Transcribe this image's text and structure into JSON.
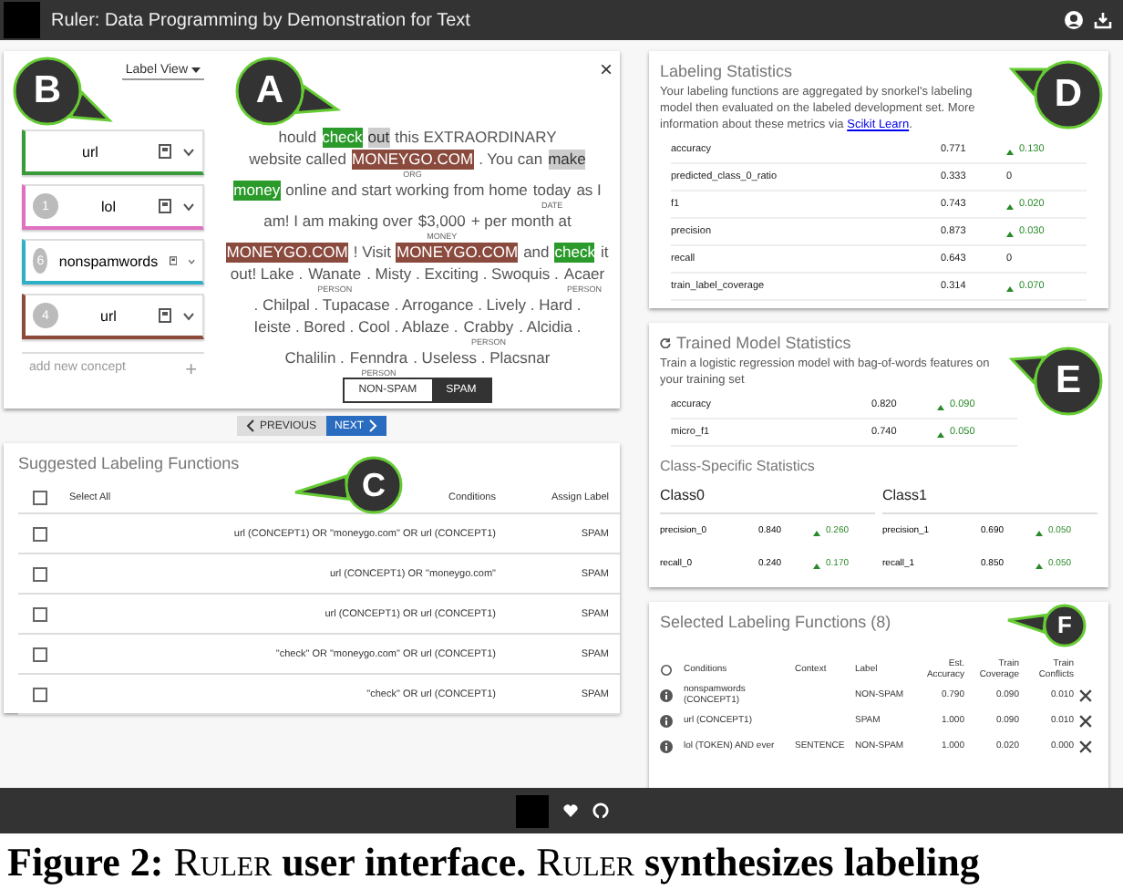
{
  "header": {
    "title": "Ruler: Data Programming by Demonstration for Text"
  },
  "concept_panel": {
    "view_menu": "Label View",
    "concepts": [
      {
        "name": "url",
        "color": "#3a9a3a"
      },
      {
        "count": "1",
        "name": "lol",
        "color": "#e070c0"
      },
      {
        "count": "6",
        "name": "nonspamwords",
        "color": "#30b0c8"
      },
      {
        "count": "4",
        "name": "url",
        "color": "#8b4a3a"
      }
    ],
    "add_label": "add new concept",
    "add_button": "+"
  },
  "document": {
    "close": "×",
    "lines": [
      [
        {
          "text": "hould"
        },
        {
          "text": "check",
          "kind": "concept"
        },
        {
          "text": "out",
          "kind": "selected"
        },
        {
          "text": "this EXTRAORDINARY"
        }
      ],
      [
        {
          "text": "website called"
        },
        {
          "text": "MONEYGO.COM",
          "kind": "match",
          "tag": "ORG"
        },
        {
          "text": ". You can"
        },
        {
          "text": "make",
          "kind": "selected"
        }
      ],
      [
        {
          "text": "money",
          "kind": "concept"
        },
        {
          "text": "online and start working from home"
        },
        {
          "text": "today",
          "tag": "DATE"
        },
        {
          "text": "as I"
        }
      ],
      [
        {
          "text": "am! I am making over"
        },
        {
          "text": "$3,000",
          "tag": "MONEY"
        },
        {
          "text": "+ per month at"
        }
      ],
      [
        {
          "text": "MONEYGO.COM",
          "kind": "match"
        },
        {
          "text": "! Visit"
        },
        {
          "text": "MONEYGO.COM",
          "kind": "match"
        },
        {
          "text": "and"
        },
        {
          "text": "check",
          "kind": "concept"
        },
        {
          "text": "it"
        }
      ],
      [
        {
          "text": "out! Lake ."
        },
        {
          "text": "Wanate",
          "tag": "PERSON"
        },
        {
          "text": ". Misty . Exciting . Swoquis ."
        },
        {
          "text": "Acaer",
          "tag": "PERSON"
        }
      ],
      [
        {
          "text": ". Chilpal . Tupacase . Arrogance . Lively . Hard ."
        }
      ],
      [
        {
          "text": "Ieiste . Bored . Cool . Ablaze ."
        },
        {
          "text": "Crabby",
          "tag": "PERSON"
        },
        {
          "text": ". Alcidia ."
        }
      ],
      [
        {
          "text": "Chalilin ."
        },
        {
          "text": "Fenndra",
          "tag": "PERSON"
        },
        {
          "text": ". Useless . Placsnar"
        }
      ]
    ],
    "label_toggle": [
      {
        "label": "NON-SPAM",
        "selected": false
      },
      {
        "label": "SPAM",
        "selected": true
      }
    ]
  },
  "navigation": [
    {
      "label": "PREVIOUS",
      "kind": "back"
    },
    {
      "label": "NEXT",
      "kind": "forward"
    }
  ],
  "suggested": {
    "title": "Suggested Labeling Functions",
    "select_all": "Select All",
    "select_all_checked": false,
    "columns": [
      "Conditions",
      "Assign Label"
    ],
    "rows": [
      {
        "checked": false,
        "conditions": "url (CONCEPT1) OR \"moneygo.com\" OR url (CONCEPT1)",
        "label": "SPAM"
      },
      {
        "checked": false,
        "conditions": "url (CONCEPT1) OR \"moneygo.com\"",
        "label": "SPAM"
      },
      {
        "checked": false,
        "conditions": "url (CONCEPT1) OR url (CONCEPT1)",
        "label": "SPAM"
      },
      {
        "checked": false,
        "conditions": "\"check\" OR \"moneygo.com\" OR url (CONCEPT1)",
        "label": "SPAM"
      },
      {
        "checked": false,
        "conditions": "\"check\" OR url (CONCEPT1)",
        "label": "SPAM"
      }
    ]
  },
  "labeling_stats": {
    "title": "Labeling Statistics",
    "description": "Your labeling functions are aggregated by snorkel's labeling model then evaluated on the labeled development set. More information about these metrics via",
    "link": "Scikit Learn",
    "after_link": ".",
    "rows": [
      {
        "metric": "accuracy",
        "value": "0.771",
        "change": "0.130",
        "up": true
      },
      {
        "metric": "predicted_class_0_ratio",
        "value": "0.333",
        "change": "0",
        "up": false
      },
      {
        "metric": "f1",
        "value": "0.743",
        "change": "0.020",
        "up": true
      },
      {
        "metric": "precision",
        "value": "0.873",
        "change": "0.030",
        "up": true
      },
      {
        "metric": "recall",
        "value": "0.643",
        "change": "0",
        "up": false
      },
      {
        "metric": "train_label_coverage",
        "value": "0.314",
        "change": "0.070",
        "up": true
      }
    ]
  },
  "model_stats": {
    "title": "Trained Model Statistics",
    "description": "Train a logistic regression model with bag-of-words features on your training set",
    "rows": [
      {
        "metric": "accuracy",
        "value": "0.820",
        "change": "0.090",
        "up": true
      },
      {
        "metric": "micro_f1",
        "value": "0.740",
        "change": "0.050",
        "up": true
      }
    ],
    "class_title": "Class-Specific Statistics",
    "classes": [
      {
        "name": "Class0",
        "rows": [
          {
            "metric": "precision_0",
            "value": "0.840",
            "change": "0.260",
            "up": true
          },
          {
            "metric": "recall_0",
            "value": "0.240",
            "change": "0.170",
            "up": true
          }
        ]
      },
      {
        "name": "Class1",
        "rows": [
          {
            "metric": "precision_1",
            "value": "0.690",
            "change": "0.050",
            "up": true
          },
          {
            "metric": "recall_1",
            "value": "0.850",
            "change": "0.050",
            "up": true
          }
        ]
      }
    ]
  },
  "selected_lfs": {
    "title": "Selected Labeling Functions (8)",
    "columns": [
      "Conditions",
      "Context",
      "Label",
      "Est. Accuracy",
      "Train Coverage",
      "Train Conflicts"
    ],
    "rows": [
      {
        "conditions": "nonspamwords (CONCEPT1)",
        "label": "NON-SPAM",
        "accuracy": "0.790",
        "coverage": "0.090",
        "conflicts": "0.010"
      },
      {
        "conditions": "url (CONCEPT1)",
        "label": "SPAM",
        "accuracy": "1.000",
        "coverage": "0.090",
        "conflicts": "0.010"
      },
      {
        "conditions": "lol (TOKEN) AND ever",
        "context": "SENTENCE",
        "label": "NON-SPAM",
        "accuracy": "1.000",
        "coverage": "0.020",
        "conflicts": "0.000"
      }
    ]
  },
  "callouts": [
    {
      "label": "B"
    },
    {
      "label": "A"
    },
    {
      "label": "C"
    },
    {
      "label": "D"
    },
    {
      "label": "E"
    },
    {
      "label": "F"
    }
  ],
  "caption": [
    {
      "text": "Figure 2:",
      "kind": "bold"
    },
    {
      "text": "Ruler",
      "kind": "smallcaps"
    },
    {
      "text": "user interface.",
      "kind": "bold"
    },
    {
      "text": "Ruler",
      "kind": "smallcaps"
    },
    {
      "text": "synthesizes labeling",
      "kind": "bold"
    }
  ]
}
